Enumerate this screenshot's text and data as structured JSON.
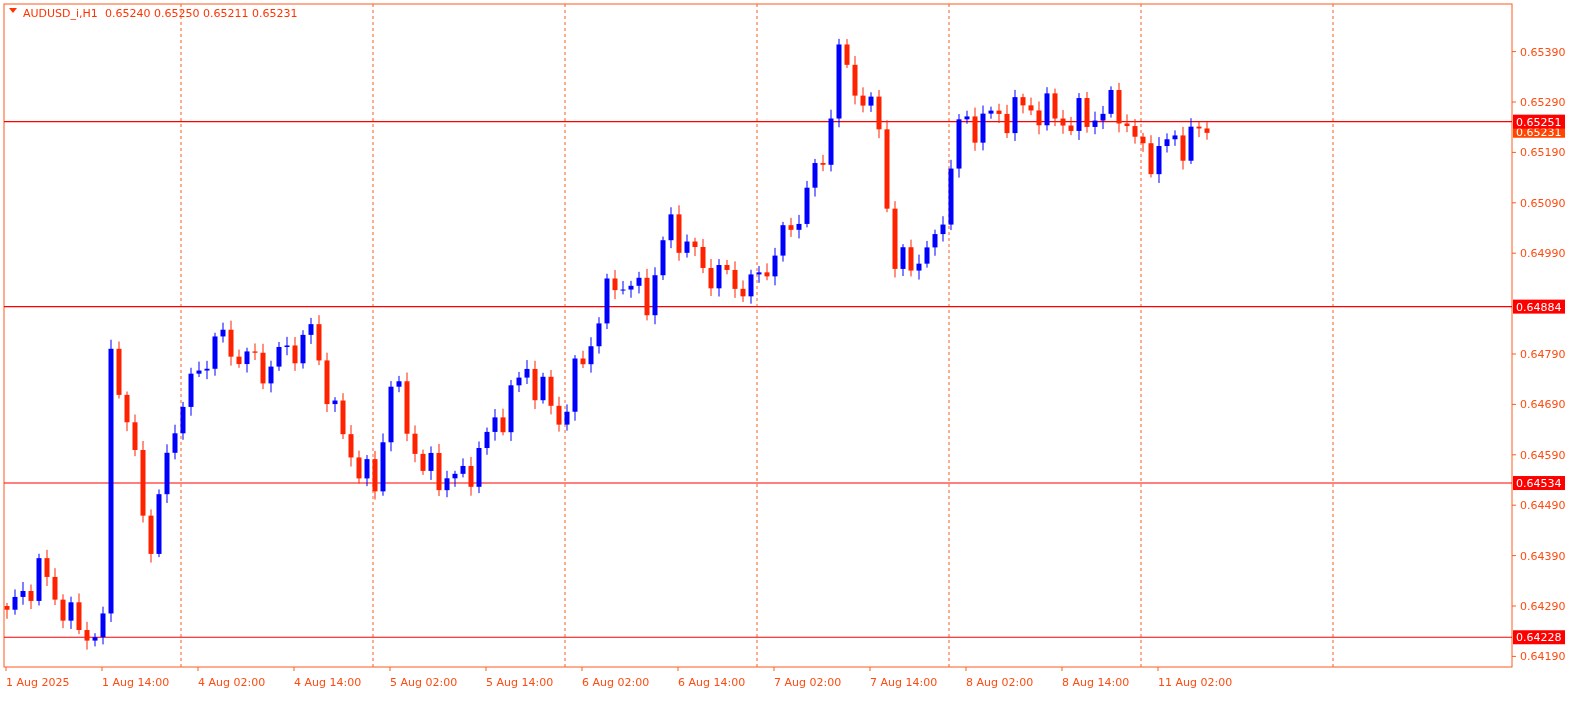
{
  "chart_header": {
    "symbol": "AUDUSD_i,H1",
    "quote": "0.65240 0.65250 0.65211 0.65231"
  },
  "y_axis": [
    "0.65390",
    "0.65290",
    "0.65190",
    "0.65090",
    "0.64990",
    "0.64790",
    "0.64690",
    "0.64590",
    "0.64490",
    "0.64390",
    "0.64290",
    "0.64190"
  ],
  "x_axis": [
    "1 Aug 2025",
    "1 Aug 14:00",
    "4 Aug 02:00",
    "4 Aug 14:00",
    "5 Aug 02:00",
    "5 Aug 14:00",
    "6 Aug 02:00",
    "6 Aug 14:00",
    "7 Aug 02:00",
    "7 Aug 14:00",
    "8 Aug 02:00",
    "8 Aug 14:00",
    "11 Aug 02:00"
  ],
  "current_price_tag": "0.65231",
  "horizontal_levels": [
    {
      "price": "0.65251"
    },
    {
      "price": "0.64884"
    },
    {
      "price": "0.64534"
    },
    {
      "price": "0.64228"
    }
  ]
}
